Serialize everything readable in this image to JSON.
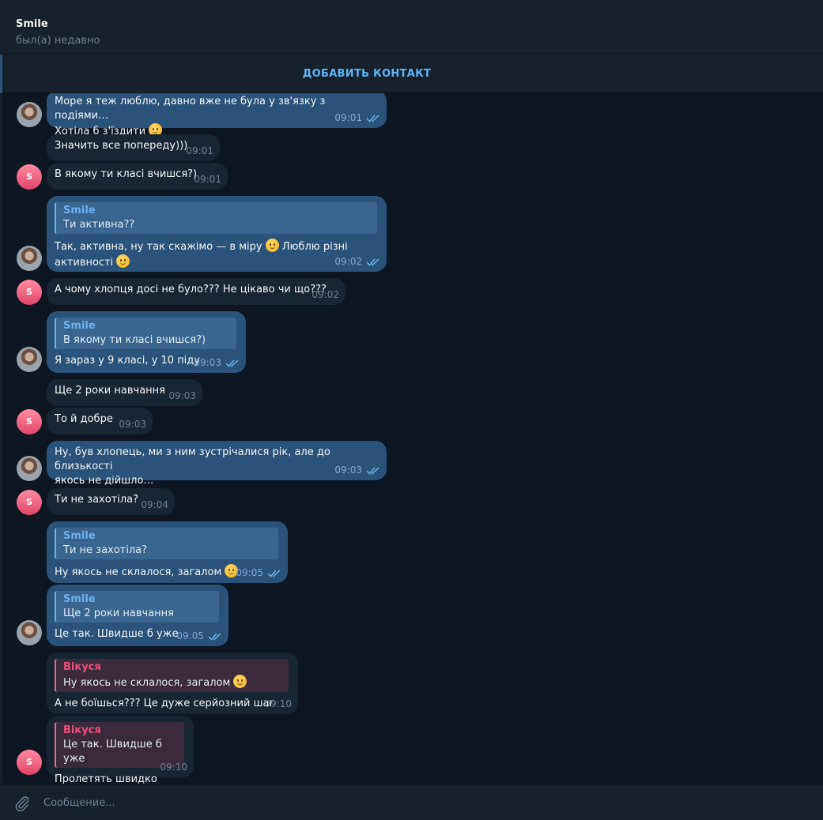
{
  "header": {
    "title": "Smile",
    "status": "был(а) недавно"
  },
  "add_contact": {
    "label": "ДОБАВИТЬ КОНТАКТ"
  },
  "messages": [
    {
      "text": "Море я теж люблю, давно вже не була у зв'язку з подіями…\nХотіла б з'їздити",
      "time": "09:01"
    },
    {
      "text": "Значить все попереду)))",
      "time": "09:01"
    },
    {
      "text": "В якому ти класі вчишся?)",
      "time": "09:01"
    },
    {
      "reply_name": "Smile",
      "reply_text": "Ти активна??",
      "text": "Так, активна, ну так скажімо — в міру",
      "text2": " Люблю різні\nактивності ",
      "time": "09:02"
    },
    {
      "text": "А чому хлопця досі не було??? Не цікаво чи що???",
      "time": "09:02"
    },
    {
      "reply_name": "Smile",
      "reply_text": "В якому ти класі вчишся?)",
      "text": "Я зараз у 9 класі, у 10 піду",
      "time": "09:03"
    },
    {
      "text": "Ще 2 роки навчання",
      "time": "09:03"
    },
    {
      "text": "То й добре",
      "time": "09:03"
    },
    {
      "text": "Ну, був хлопець, ми з ним зустрічалися рік, але до близькості\nякось не дійшло…",
      "time": "09:03"
    },
    {
      "text": "Ти не захотіла?",
      "time": "09:04"
    },
    {
      "reply_name": "Smile",
      "reply_text": "Ти не захотіла?",
      "text": "Ну якось не склалося, загалом ",
      "time": "09:05"
    },
    {
      "reply_name": "Smile",
      "reply_text": "Ще 2 роки навчання",
      "text": "Це так. Швидше б уже",
      "time": "09:05"
    },
    {
      "reply_name": "Вікуся",
      "reply_text": "Ну якось не склалося, загалом ",
      "text": "А не боїшься??? Це дуже серйозний шаг",
      "time": "09:10"
    },
    {
      "reply_name": "Вікуся",
      "reply_text": "Це так. Швидше б уже",
      "text": "Пролетять швидко",
      "time": "09:10"
    }
  ],
  "avatars": {
    "contact_initial": "S"
  },
  "composer": {
    "placeholder": "Сообщение..."
  },
  "colors": {
    "outgoing": "#2b5278",
    "incoming": "#182533",
    "accent": "#5eb5f7",
    "background": "#0e1621"
  }
}
